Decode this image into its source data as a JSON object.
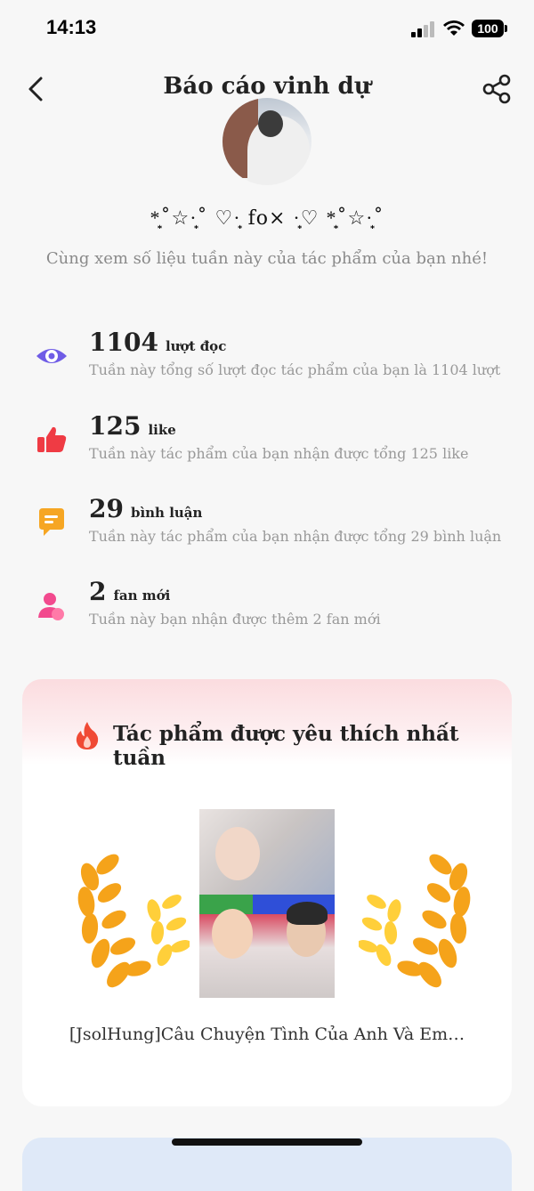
{
  "status": {
    "time": "14:13",
    "battery": "100"
  },
  "nav": {
    "title": "Báo cáo vinh dự"
  },
  "profile": {
    "username": "*͙͙˚☆·̩͙˚ ♡·̩͙ fo× ·̩͙♡ *͙͙˚☆·̩͙˚",
    "subtitle": "Cùng xem số liệu tuần này của tác phẩm của bạn nhé!"
  },
  "stats": [
    {
      "icon": "eye-icon",
      "number": "1104",
      "unit": "lượt đọc",
      "desc": "Tuần này tổng số lượt đọc tác phẩm của bạn là 1104 lượt",
      "color": "#6f5ce6"
    },
    {
      "icon": "thumbs-up-icon",
      "number": "125",
      "unit": "like",
      "desc": "Tuần này tác phẩm của bạn nhận được tổng 125 like",
      "color": "#ef3b44"
    },
    {
      "icon": "comment-icon",
      "number": "29",
      "unit": "bình luận",
      "desc": "Tuần này tác phẩm của bạn nhận được tổng 29 bình luận",
      "color": "#f6a623"
    },
    {
      "icon": "person-icon",
      "number": "2",
      "unit": "fan mới",
      "desc": "Tuần này bạn nhận được thêm 2 fan mới",
      "color": "#f24a8e"
    }
  ],
  "featured": {
    "title": "Tác phẩm được yêu thích nhất tuần",
    "book_title": "[JsolHung]Câu Chuyện Tình Của Anh Và Em…"
  },
  "colors": {
    "laurel": "#f5a31a",
    "laurel_light": "#ffcf3a",
    "fire": "#f04a35"
  }
}
